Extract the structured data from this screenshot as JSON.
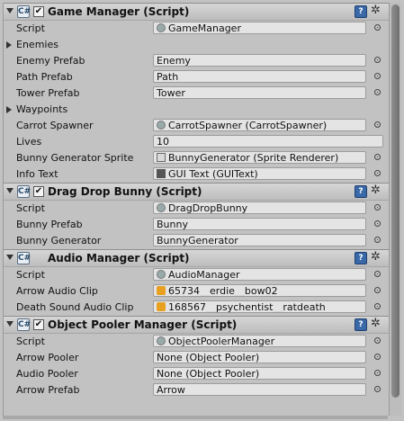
{
  "components": [
    {
      "title": "Game Manager (Script)",
      "has_checkbox": true,
      "rows": [
        {
          "label": "Script",
          "value": "GameManager",
          "icon": "script",
          "picker": true
        },
        {
          "label": "Enemies",
          "foldout": true
        },
        {
          "label": "Enemy Prefab",
          "value": "Enemy",
          "picker": true
        },
        {
          "label": "Path Prefab",
          "value": "Path",
          "picker": true
        },
        {
          "label": "Tower Prefab",
          "value": "Tower",
          "picker": true
        },
        {
          "label": "Waypoints",
          "foldout": true
        },
        {
          "label": "Carrot Spawner",
          "value": "CarrotSpawner (CarrotSpawner)",
          "icon": "script",
          "picker": true
        },
        {
          "label": "Lives",
          "value": "10",
          "wide": true
        },
        {
          "label": "Bunny Generator Sprite",
          "value": "BunnyGenerator (Sprite Renderer)",
          "icon": "obj",
          "picker": true
        },
        {
          "label": "Info Text",
          "value": "GUI Text (GUIText)",
          "icon": "text",
          "picker": true
        }
      ]
    },
    {
      "title": "Drag Drop Bunny (Script)",
      "has_checkbox": true,
      "rows": [
        {
          "label": "Script",
          "value": "DragDropBunny",
          "icon": "script",
          "picker": true
        },
        {
          "label": "Bunny Prefab",
          "value": "Bunny",
          "picker": true
        },
        {
          "label": "Bunny Generator",
          "value": "BunnyGenerator",
          "picker": true
        }
      ]
    },
    {
      "title": "Audio Manager (Script)",
      "has_checkbox": false,
      "rows": [
        {
          "label": "Script",
          "value": "AudioManager",
          "icon": "script",
          "picker": true
        },
        {
          "label": "Arrow Audio Clip",
          "value": "65734__erdie__bow02",
          "icon": "audio",
          "picker": true
        },
        {
          "label": "Death Sound Audio Clip",
          "value": "168567__psychentist__ratdeath",
          "icon": "audio",
          "picker": true
        }
      ]
    },
    {
      "title": "Object Pooler Manager (Script)",
      "has_checkbox": true,
      "rows": [
        {
          "label": "Script",
          "value": "ObjectPoolerManager",
          "icon": "script",
          "picker": true
        },
        {
          "label": "Arrow Pooler",
          "value": "None (Object Pooler)",
          "picker": true
        },
        {
          "label": "Audio Pooler",
          "value": "None (Object Pooler)",
          "picker": true
        },
        {
          "label": "Arrow Prefab",
          "value": "Arrow",
          "picker": true
        }
      ]
    }
  ],
  "header_icons": {
    "component": "C#",
    "checkmark": "✔",
    "help": "?",
    "gear": "✲"
  }
}
